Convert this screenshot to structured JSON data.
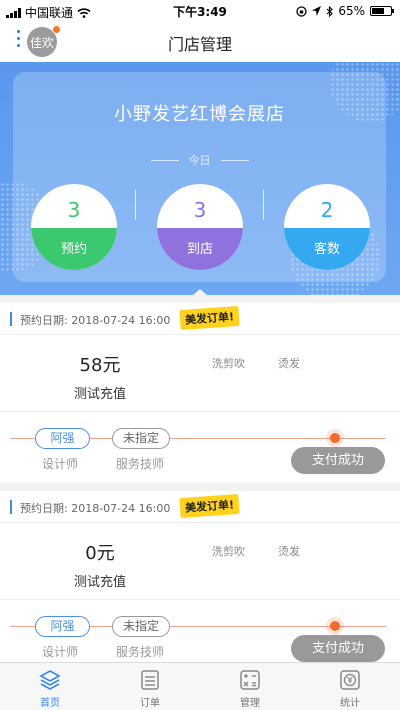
{
  "status_bar": {
    "carrier": "中国联通",
    "time": "下午3:49",
    "battery": "65%",
    "battery_level": 0.65
  },
  "header": {
    "title": "门店管理",
    "avatar_text": "佳欢"
  },
  "hero": {
    "store_name": "小野发艺红博会展店",
    "today_label": "今日",
    "stats": [
      {
        "value": "3",
        "label": "预约",
        "color": "#3cc86e"
      },
      {
        "value": "3",
        "label": "到店",
        "color": "#8f72dd"
      },
      {
        "value": "2",
        "label": "客数",
        "color": "#34a8f0"
      }
    ]
  },
  "orders": [
    {
      "date": "预约日期: 2018-07-24 16:00",
      "tag": "美发订单!",
      "price": "58元",
      "product": "测试充值",
      "services": [
        "洗剪吹",
        "烫发"
      ],
      "designer": "阿强",
      "tech": "未指定",
      "designer_role": "设计师",
      "tech_role": "服务技师",
      "status": "支付成功"
    },
    {
      "date": "预约日期: 2018-07-24 16:00",
      "tag": "美发订单!",
      "price": "0元",
      "product": "测试充值",
      "services": [
        "洗剪吹",
        "烫发"
      ],
      "designer": "阿强",
      "tech": "未指定",
      "designer_role": "设计师",
      "tech_role": "服务技师",
      "status": "支付成功"
    }
  ],
  "tabs": [
    {
      "label": "首页",
      "icon": "layers-icon"
    },
    {
      "label": "订单",
      "icon": "order-icon"
    },
    {
      "label": "管理",
      "icon": "calculator-icon"
    },
    {
      "label": "统计",
      "icon": "yen-icon"
    }
  ],
  "colors": {
    "accent": "#3a86e4",
    "hero_bg": "#5a97ee",
    "status_button": "#999999",
    "tag_bg": "#ffd21e"
  }
}
